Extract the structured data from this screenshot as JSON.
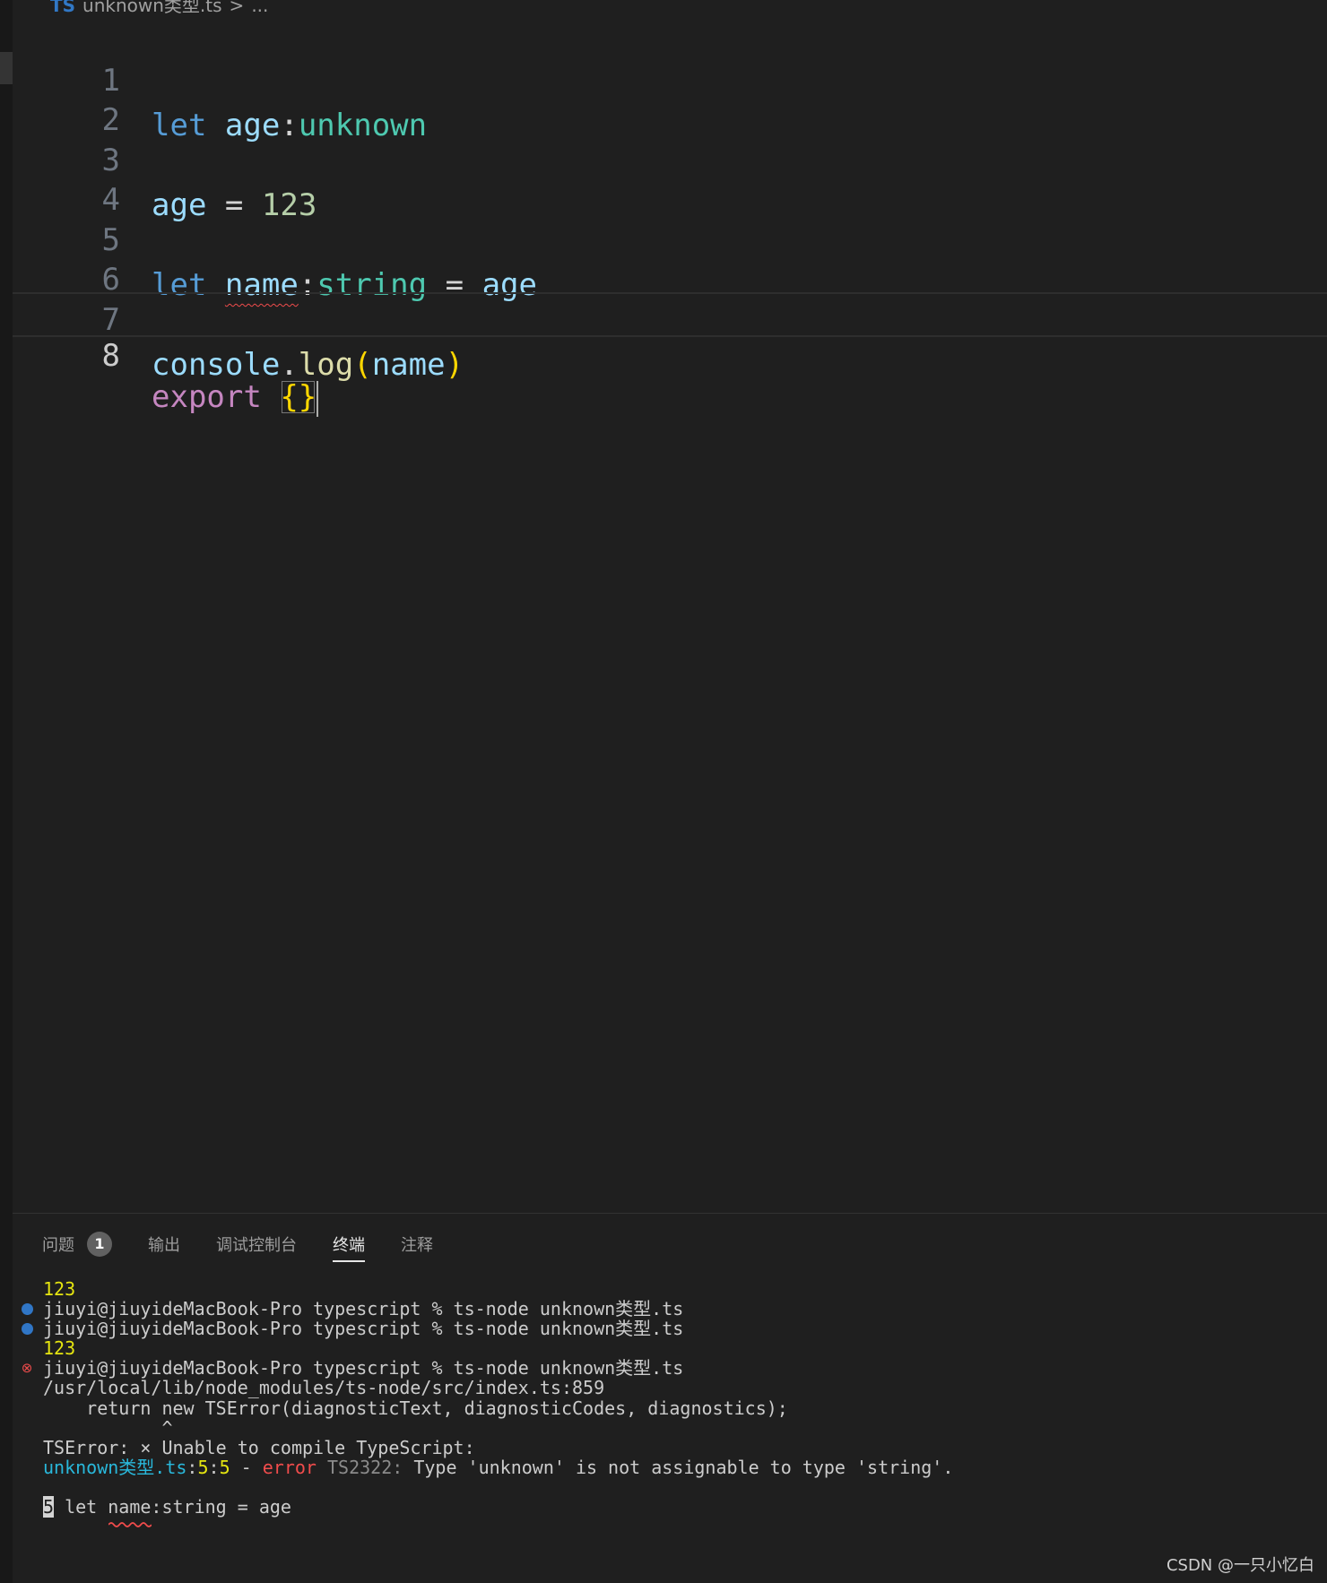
{
  "breadcrumb": {
    "file_icon": "TS",
    "file": "unknown类型.ts",
    "separator": ">",
    "more": "..."
  },
  "editor": {
    "line_numbers": [
      "1",
      "2",
      "3",
      "4",
      "5",
      "6",
      "7",
      "8"
    ],
    "line1": {
      "kw": "let",
      "var": "age",
      "colon": ":",
      "type": "unknown"
    },
    "line3": {
      "var": "age",
      "op": "=",
      "num": "123"
    },
    "line5": {
      "kw": "let",
      "var": "name",
      "colon": ":",
      "type": "string",
      "op": "=",
      "rhs": "age"
    },
    "line7": {
      "obj": "console",
      "dot": ".",
      "fn": "log",
      "lp": "(",
      "arg": "name",
      "rp": ")"
    },
    "line8": {
      "kw": "export",
      "braces": "{}"
    }
  },
  "panel": {
    "tabs": [
      {
        "label": "问题",
        "badge": "1"
      },
      {
        "label": "输出"
      },
      {
        "label": "调试控制台"
      },
      {
        "label": "终端",
        "active": true
      },
      {
        "label": "注释"
      }
    ]
  },
  "terminal": {
    "out1": "123",
    "cmd1": "jiuyi@jiuyideMacBook-Pro typescript % ts-node unknown类型.ts",
    "cmd2": "jiuyi@jiuyideMacBook-Pro typescript % ts-node unknown类型.ts",
    "out2": "123",
    "cmd3": "jiuyi@jiuyideMacBook-Pro typescript % ts-node unknown类型.ts",
    "trace1": "/usr/local/lib/node_modules/ts-node/src/index.ts:859",
    "trace2": "    return new TSError(diagnosticText, diagnosticCodes, diagnostics);",
    "caret": "           ^",
    "tserror": "TSError: × Unable to compile TypeScript:",
    "diag": {
      "file": "unknown类型.ts",
      "colon1": ":",
      "line": "5",
      "colon2": ":",
      "col": "5",
      "dash": " - ",
      "severity": "error",
      "code": " TS2322:",
      "message": " Type 'unknown' is not assignable to type 'string'."
    },
    "src_line_no": "5",
    "src_line": " let name:string = age"
  },
  "watermark": "CSDN @一只小忆白",
  "colors": {
    "background": "#1f1f1f",
    "keyword": "#569cd6",
    "variable": "#9cdcfe",
    "type": "#4ec9b0",
    "number": "#b5cea8",
    "function": "#dcdcaa",
    "error": "#f14c4c",
    "terminal_yellow": "#e5e510",
    "terminal_cyan": "#29b8db"
  }
}
